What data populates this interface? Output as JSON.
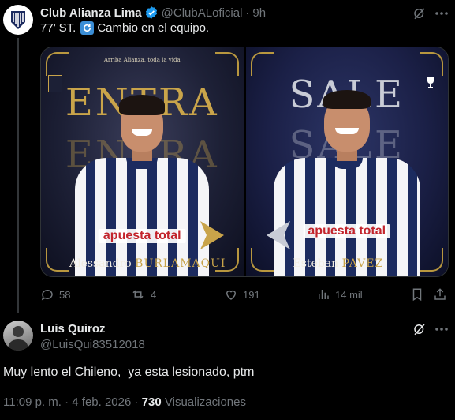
{
  "tweet1": {
    "author_name": "Club Alianza Lima",
    "handle": "@ClubALoficial",
    "separator": "·",
    "time": "9h",
    "text_before_emoji": "77’ ST.",
    "text_after_emoji": "Cambio en el equipo.",
    "emoji_name": "arrows-counterclockwise-icon",
    "media": {
      "left": {
        "top_caption": "Arriba Alianza, toda la vida",
        "headline": "ENTRA",
        "player_first": "Alessandro",
        "player_last": "BURLAMAQUI",
        "sponsor": "apuesta total"
      },
      "right": {
        "headline": "SALE",
        "player_first": "Esteban",
        "player_last": "PAVEZ",
        "sponsor": "apuesta total"
      }
    },
    "actions": {
      "replies": "58",
      "reposts": "4",
      "likes": "191",
      "views": "14 mil"
    }
  },
  "tweet2": {
    "author_name": "Luis Quiroz",
    "handle": "@LuisQui83512018",
    "text": "Muy lento el Chileno,  ya esta lesionado, ptm",
    "timestamp": "11:09 p. m. · 4 feb. 2026 ·",
    "views_count": "730",
    "views_label": "Visualizaciones"
  },
  "colors": {
    "background": "#000000",
    "text_primary": "#e7e9ea",
    "text_secondary": "#71767b",
    "verified_blue": "#1d9bf0",
    "gold": "#c9a44a",
    "club_navy": "#1c2b5f"
  }
}
